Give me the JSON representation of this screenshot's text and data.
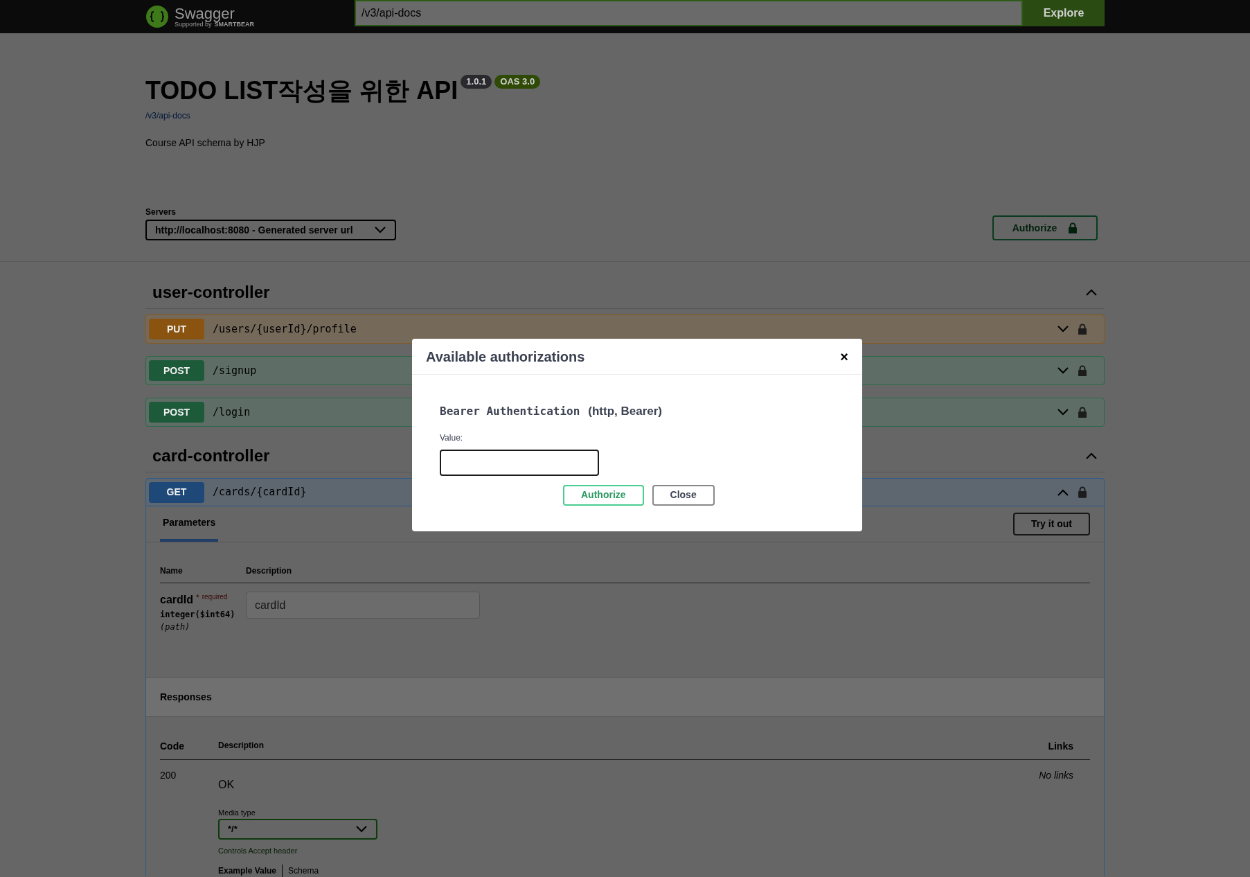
{
  "topbar": {
    "logo_text": "Swagger",
    "logo_supported": "Supported by",
    "logo_company": "SMARTBEAR",
    "url": "/v3/api-docs",
    "explore_button": "Explore"
  },
  "info": {
    "title": "TODO LIST작성을 위한 API",
    "version": "1.0.1",
    "oas": "OAS 3.0",
    "spec_link": "/v3/api-docs",
    "description": "Course API schema by HJP"
  },
  "servers": {
    "label": "Servers",
    "selected": "http://localhost:8080 - Generated server url"
  },
  "authorize_button": "Authorize",
  "tags": [
    {
      "name": "user-controller",
      "expanded": true,
      "operations": [
        {
          "method": "PUT",
          "path": "/users/{userId}/profile",
          "expanded": false
        },
        {
          "method": "POST",
          "path": "/signup",
          "expanded": false
        },
        {
          "method": "POST",
          "path": "/login",
          "expanded": false
        }
      ]
    },
    {
      "name": "card-controller",
      "expanded": true,
      "operations": [
        {
          "method": "GET",
          "path": "/cards/{cardId}",
          "expanded": true,
          "details": {
            "tabs": [
              {
                "label": "Parameters",
                "selected": true
              }
            ],
            "try_button": "Try it out",
            "param_columns": [
              "Name",
              "Description"
            ],
            "params": [
              {
                "name": "cardId",
                "required_mark": "*",
                "required_label": "required",
                "type": "integer($int64)",
                "location": "(path)",
                "placeholder": "cardId"
              }
            ],
            "responses_title": "Responses",
            "response_columns": [
              "Code",
              "Description",
              "Links"
            ],
            "responses": [
              {
                "code": "200",
                "description": "OK",
                "media_type_label": "Media type",
                "media_type": "*/*",
                "media_hint": "Controls Accept header",
                "example_tabs": [
                  {
                    "label": "Example Value",
                    "selected": true
                  },
                  {
                    "label": "Schema",
                    "selected": false
                  }
                ],
                "links": "No links"
              }
            ]
          }
        }
      ]
    }
  ],
  "modal": {
    "title": "Available authorizations",
    "close_icon": "×",
    "scheme_name": "Bearer Authentication",
    "scheme_kind": "(http, Bearer)",
    "value_label": "Value:",
    "buttons": [
      {
        "label": "Authorize",
        "kind": "primary"
      },
      {
        "label": "Close",
        "kind": "secondary"
      }
    ]
  }
}
